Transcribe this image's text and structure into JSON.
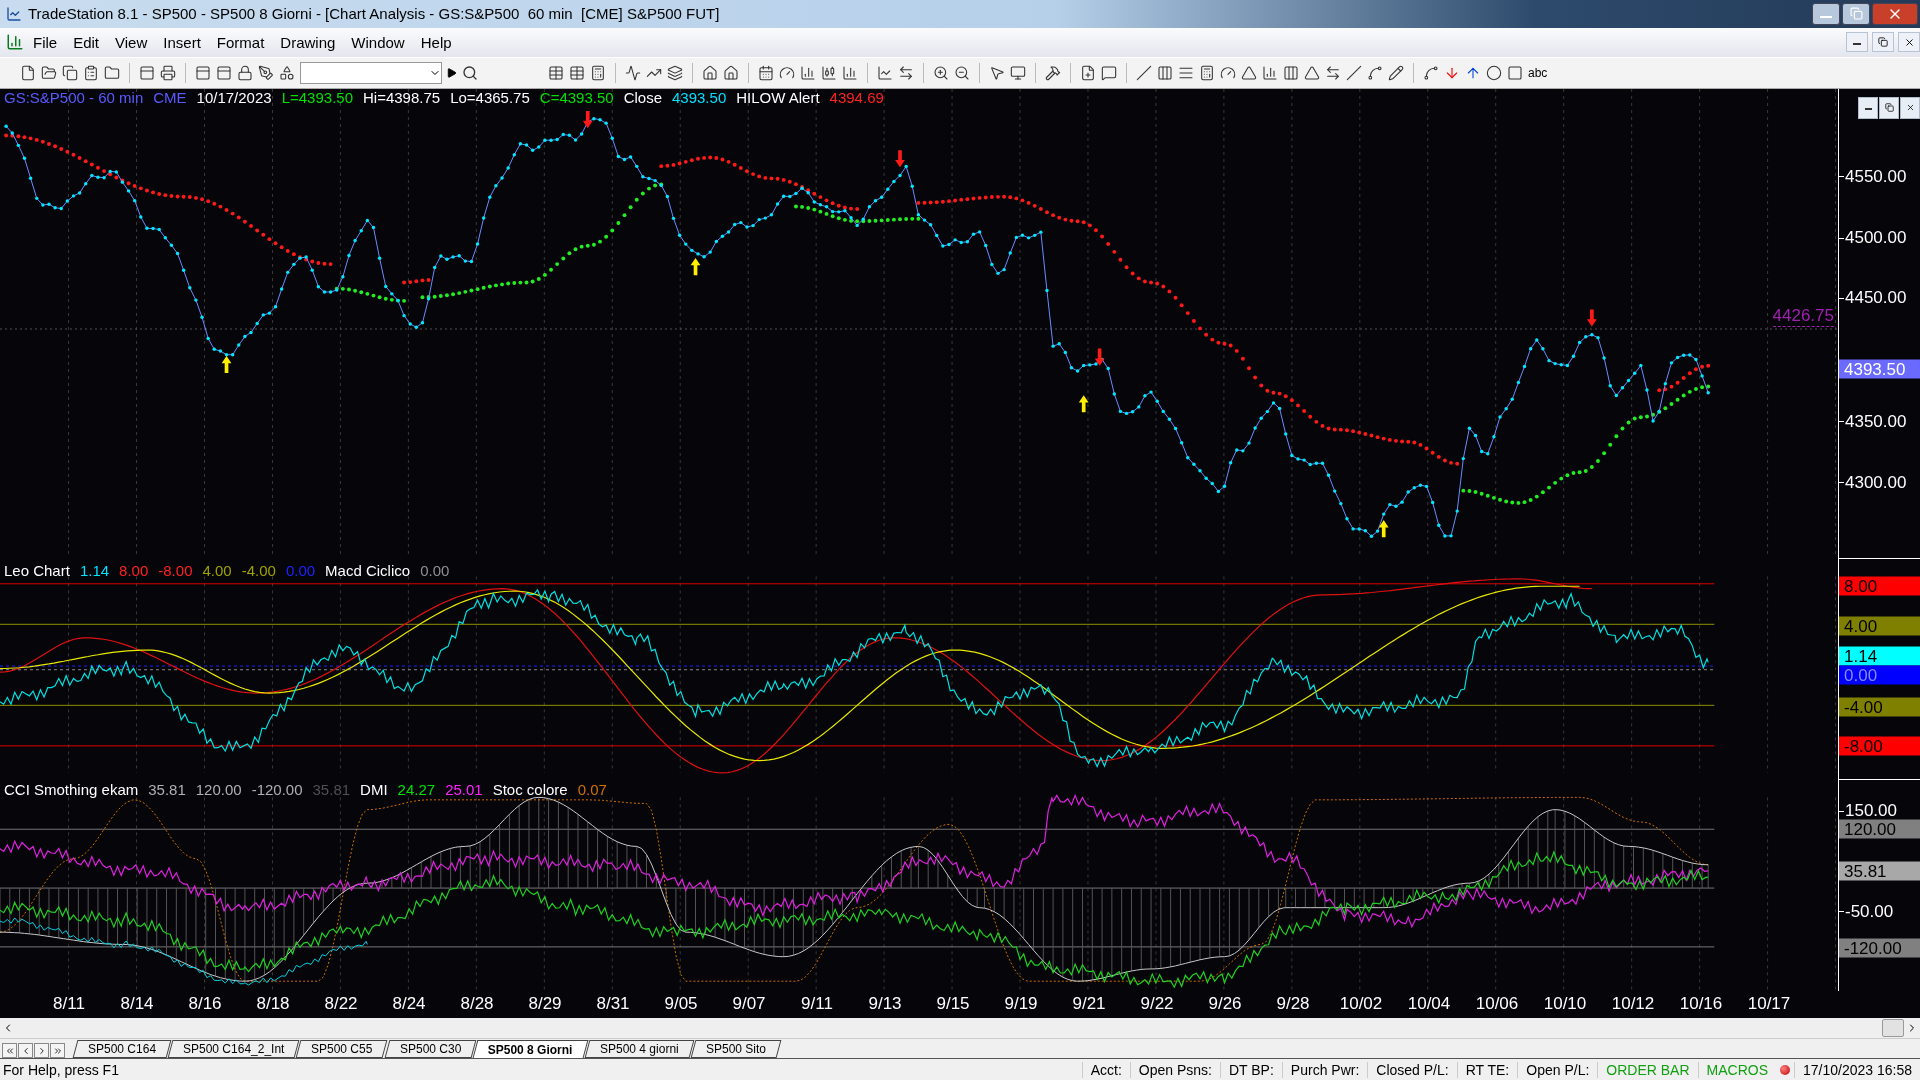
{
  "window": {
    "title": "TradeStation 8.1 - SP500 - SP500 8 Giorni - [Chart Analysis - GS:S&P500  60 min  [CME] S&P500 FUT]"
  },
  "menu": [
    "File",
    "Edit",
    "View",
    "Insert",
    "Format",
    "Drawing",
    "Window",
    "Help"
  ],
  "toolbar": {
    "text_tool": "abc"
  },
  "price_panel": {
    "legend": [
      {
        "text": "GS:S&P500 - 60 min",
        "color": "#5a5aff"
      },
      {
        "text": "CME",
        "color": "#5a5aff"
      },
      {
        "text": "10/17/2023",
        "color": "#ffffff"
      },
      {
        "text": "L=4393.50",
        "color": "#00e000"
      },
      {
        "text": "Hi=4398.75",
        "color": "#ffffff"
      },
      {
        "text": "Lo=4365.75",
        "color": "#ffffff"
      },
      {
        "text": "C=4393.50",
        "color": "#00e000"
      },
      {
        "text": "Close",
        "color": "#ffffff"
      },
      {
        "text": "4393.50",
        "color": "#00e0ff"
      },
      {
        "text": "HILOW Alert",
        "color": "#ffffff"
      },
      {
        "text": "4394.69",
        "color": "#ff2020"
      }
    ],
    "alert_level": "4426.75",
    "axis": [
      "4550.00",
      "4500.00",
      "4450.00",
      "4350.00",
      "4300.00"
    ],
    "badges": [
      {
        "text": "4393.50",
        "color": "#6a6aff"
      }
    ]
  },
  "leo_panel": {
    "legend": [
      {
        "text": "Leo Chart",
        "color": "#ffffff"
      },
      {
        "text": "1.14",
        "color": "#00e0ff"
      },
      {
        "text": "8.00",
        "color": "#ff2020"
      },
      {
        "text": "-8.00",
        "color": "#ff2020"
      },
      {
        "text": "4.00",
        "color": "#a0a000"
      },
      {
        "text": "-4.00",
        "color": "#a0a000"
      },
      {
        "text": "0.00",
        "color": "#2020ff"
      },
      {
        "text": "Macd Ciclico",
        "color": "#ffffff"
      },
      {
        "text": "0.00",
        "color": "#909090"
      }
    ],
    "badges": [
      {
        "text": "8.00",
        "color": "#ff0000"
      },
      {
        "text": "4.00",
        "color": "#808000"
      },
      {
        "text": "1.14",
        "color": "#00ffff"
      },
      {
        "text": "0.00",
        "color": "#0000ff"
      },
      {
        "text": "-4.00",
        "color": "#808000"
      },
      {
        "text": "-8.00",
        "color": "#ff0000"
      }
    ]
  },
  "cci_panel": {
    "legend": [
      {
        "text": "CCI Smothing ekam",
        "color": "#ffffff"
      },
      {
        "text": "35.81",
        "color": "#b0b0b0"
      },
      {
        "text": "120.00",
        "color": "#b0b0b0"
      },
      {
        "text": "-120.00",
        "color": "#b0b0b0"
      },
      {
        "text": "35.81",
        "color": "#505050"
      },
      {
        "text": "DMI",
        "color": "#ffffff"
      },
      {
        "text": "24.27",
        "color": "#00e000"
      },
      {
        "text": "25.01",
        "color": "#ff20ff"
      },
      {
        "text": "Stoc colore",
        "color": "#ffffff"
      },
      {
        "text": "0.07",
        "color": "#d07000"
      }
    ],
    "axis": [
      "150.00",
      "-50.00"
    ],
    "badges": [
      {
        "text": "120.00",
        "color": "#808080"
      },
      {
        "text": "35.81",
        "color": "#a8a8a8"
      },
      {
        "text": "-120.00",
        "color": "#808080"
      }
    ]
  },
  "dates": [
    "8/11",
    "8/14",
    "8/16",
    "8/18",
    "8/22",
    "8/24",
    "8/28",
    "8/29",
    "8/31",
    "9/05",
    "9/07",
    "9/11",
    "9/13",
    "9/15",
    "9/19",
    "9/21",
    "9/22",
    "9/26",
    "9/28",
    "10/02",
    "10/04",
    "10/06",
    "10/10",
    "10/12",
    "10/16",
    "10/17"
  ],
  "sheet_tabs": [
    {
      "label": "SP500 C164",
      "selected": false
    },
    {
      "label": "SP500 C164_2_Int",
      "selected": false
    },
    {
      "label": "SP500 C55",
      "selected": false
    },
    {
      "label": "SP500 C30",
      "selected": false
    },
    {
      "label": "SP500 8 Giorni",
      "selected": true
    },
    {
      "label": "SP500 4 giorni",
      "selected": false
    },
    {
      "label": "SP500 Sito",
      "selected": false
    }
  ],
  "status_bar": {
    "help": "For Help, press F1",
    "fields": [
      {
        "text": "Acct:",
        "kind": "plain"
      },
      {
        "text": "Open Psns:",
        "kind": "plain"
      },
      {
        "text": "DT BP:",
        "kind": "plain"
      },
      {
        "text": "Purch Pwr:",
        "kind": "plain"
      },
      {
        "text": "Closed P/L:",
        "kind": "plain"
      },
      {
        "text": "RT TE:",
        "kind": "plain"
      },
      {
        "text": "Open P/L:",
        "kind": "plain"
      },
      {
        "text": "ORDER BAR",
        "kind": "link"
      },
      {
        "text": "MACROS",
        "kind": "link"
      },
      {
        "text": "17/10/2023 16:58",
        "kind": "clock"
      }
    ]
  }
}
